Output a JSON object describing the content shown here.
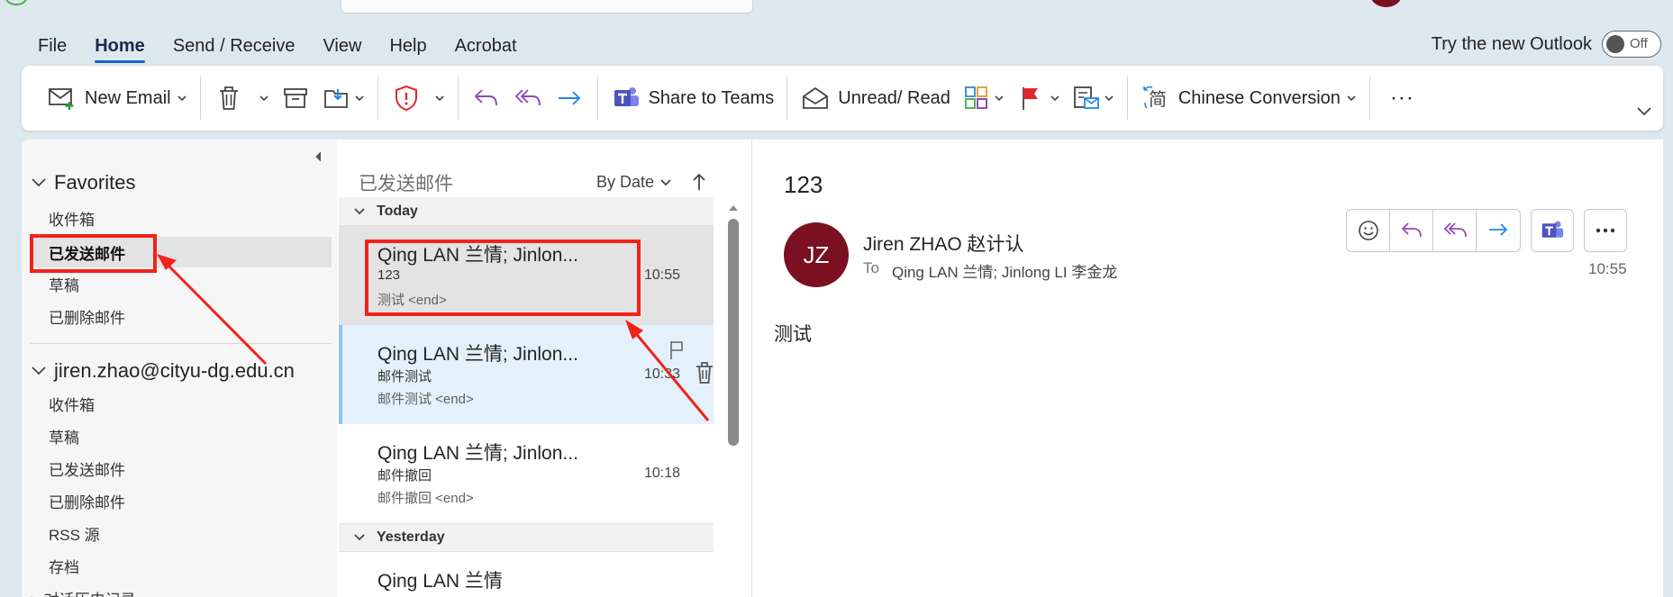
{
  "menu": {
    "tabs": [
      "File",
      "Home",
      "Send / Receive",
      "View",
      "Help",
      "Acrobat"
    ],
    "try_new": "Try the new Outlook",
    "toggle_label": "Off"
  },
  "ribbon": {
    "new_email": "New Email",
    "share_teams": "Share to Teams",
    "unread_read": "Unread/ Read",
    "chinese_conversion": "Chinese Conversion",
    "more": "···"
  },
  "folders": {
    "favorites_label": "Favorites",
    "favorites": [
      "收件箱",
      "已发送邮件",
      "草稿",
      "已删除邮件"
    ],
    "account_label": "jiren.zhao@cityu-dg.edu.cn",
    "account_items": [
      "收件箱",
      "草稿",
      "已发送邮件",
      "已删除邮件",
      "RSS 源",
      "存档",
      "对话历史记录"
    ]
  },
  "list": {
    "title": "已发送邮件",
    "sort_label": "By Date",
    "groups": [
      "Today",
      "Yesterday"
    ],
    "messages": [
      {
        "from": "Qing LAN 兰情; Jinlon...",
        "subject": "123",
        "preview": "测试 <end>",
        "time": "10:55"
      },
      {
        "from": "Qing LAN 兰情; Jinlon...",
        "subject": "邮件测试",
        "preview": "邮件测试 <end>",
        "time": "10:33"
      },
      {
        "from": "Qing LAN 兰情; Jinlon...",
        "subject": "邮件撤回",
        "preview": "邮件撤回 <end>",
        "time": "10:18"
      },
      {
        "from": "Qing LAN 兰情",
        "subject": "",
        "preview": "",
        "time": ""
      }
    ]
  },
  "reading": {
    "subject": "123",
    "avatar_initials": "JZ",
    "sender": "Jiren ZHAO 赵计认",
    "to_label": "To",
    "recipients": "Qing LAN 兰情; Jinlong LI 李金龙",
    "time": "10:55",
    "body": "测试"
  },
  "colors": {
    "accent": "#1565c0",
    "avatar": "#7a1020",
    "annotation_red": "#f2221a",
    "reply_purple": "#8e4bb8",
    "forward_blue": "#1e88e5"
  }
}
